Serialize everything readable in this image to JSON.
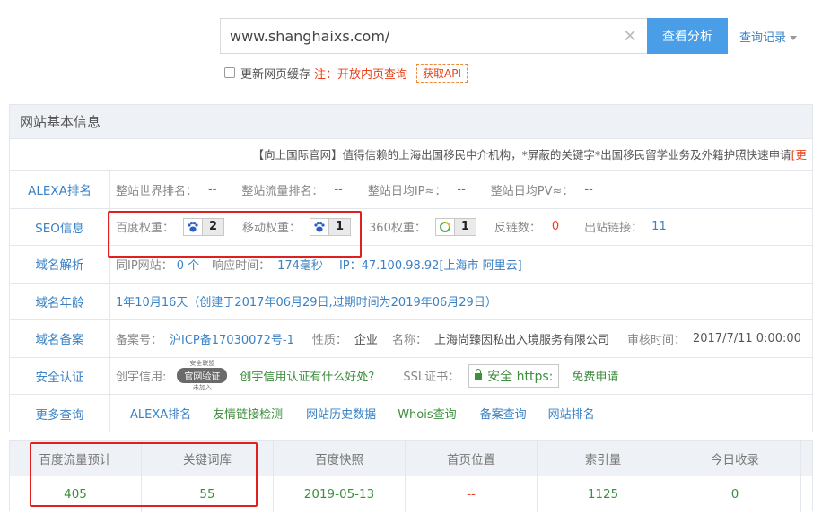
{
  "search": {
    "value": "www.shanghaixs.com/",
    "button": "查看分析",
    "history": "查询记录"
  },
  "cache": {
    "label": "更新网页缓存",
    "note": "注：开放内页查询",
    "api": "获取API"
  },
  "panel": {
    "title": "网站基本信息",
    "ad_text": "【向上国际官网】值得信赖的上海出国移民中介机构，*屏蔽的关键字*出国移民留学业务及外籍护照快速申请",
    "ad_tail": "[更",
    "alexa": {
      "label": "ALEXA排名",
      "k1": "整站世界排名：",
      "v1": "--",
      "k2": "整站流量排名：",
      "v2": "--",
      "k3": "整站日均IP≈：",
      "v3": "--",
      "k4": "整站日均PV≈：",
      "v4": "--"
    },
    "seo": {
      "label": "SEO信息",
      "baidu_k": "百度权重：",
      "baidu_v": "2",
      "mobile_k": "移动权重：",
      "mobile_v": "1",
      "q360_k": "360权重：",
      "q360_v": "1",
      "backlinks_k": "反链数：",
      "backlinks_v": "0",
      "outlinks_k": "出站链接：",
      "outlinks_v": "11"
    },
    "domain_parse": {
      "label": "域名解析",
      "sameip_k": "同IP网站：",
      "sameip_v": "0 个",
      "resp_k": "响应时间：",
      "resp_v": "174毫秒",
      "ip": "IP：47.100.98.92[上海市 阿里云]"
    },
    "domain_age": {
      "label": "域名年龄",
      "value": "1年10月16天（创建于2017年06月29日,过期时间为2019年06月29日）"
    },
    "icp": {
      "label": "域名备案",
      "no_k": "备案号：",
      "no_v": "沪ICP备17030072号-1",
      "type_k": "性质：",
      "type_v": "企业",
      "name_k": "名称：",
      "name_v": "上海尚臻因私出入境服务有限公司",
      "date_k": "审核时间：",
      "date_v": "2017/7/11 0:00:00"
    },
    "security": {
      "label": "安全认证",
      "credit_k": "创宇信用:",
      "seal_top": "安全联盟",
      "seal_mid": "官网验证",
      "seal_bot": "未加入",
      "credit_link": "创宇信用认证有什么好处？",
      "ssl_k": "SSL证书：",
      "ssl_v": "安全 https:",
      "free": "免费申请"
    },
    "more": {
      "label": "更多查询",
      "links": [
        "ALEXA排名",
        "友情链接检测",
        "网站历史数据",
        "Whois查询",
        "备案查询",
        "网站排名"
      ]
    }
  },
  "stats": {
    "headers": [
      "百度流量预计",
      "关键词库",
      "百度快照",
      "首页位置",
      "索引量",
      "今日收录"
    ],
    "values": [
      "405",
      "55",
      "2019-05-13",
      "--",
      "1125",
      "0"
    ]
  },
  "colors": {
    "accent": "#4a9ee8",
    "link": "#3a82c4",
    "green": "#3d8e3d",
    "red": "#e8421c",
    "highlight": "#e02020"
  }
}
